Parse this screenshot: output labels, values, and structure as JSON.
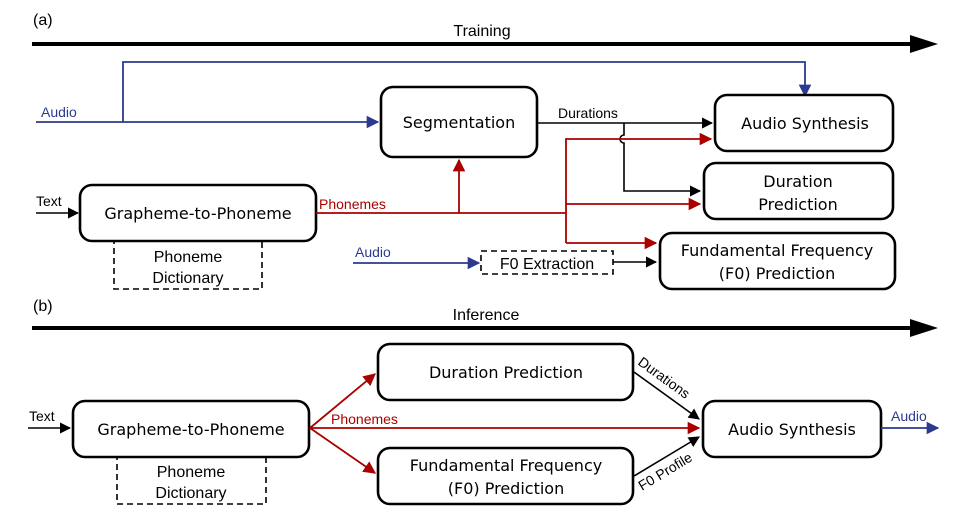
{
  "panel_a": {
    "label": "(a)",
    "timeline": "Training",
    "inputs": {
      "audio_top": "Audio",
      "text": "Text",
      "audio_f0": "Audio"
    },
    "boxes": {
      "segmentation": "Segmentation",
      "audio_synthesis": "Audio Synthesis",
      "duration_prediction": [
        "Duration",
        "Prediction"
      ],
      "f0_prediction": [
        "Fundamental Frequency",
        "(F0) Prediction"
      ],
      "g2p": "Grapheme-to-Phoneme",
      "phoneme_dictionary": [
        "Phoneme",
        "Dictionary"
      ],
      "f0_extraction": "F0 Extraction"
    },
    "edge_labels": {
      "durations": "Durations",
      "phonemes": "Phonemes"
    }
  },
  "panel_b": {
    "label": "(b)",
    "timeline": "Inference",
    "inputs": {
      "text": "Text"
    },
    "outputs": {
      "audio": "Audio"
    },
    "boxes": {
      "g2p": "Grapheme-to-Phoneme",
      "phoneme_dictionary": [
        "Phoneme",
        "Dictionary"
      ],
      "duration_prediction": "Duration Prediction",
      "f0_prediction": [
        "Fundamental Frequency",
        "(F0) Prediction"
      ],
      "audio_synthesis": "Audio Synthesis"
    },
    "edge_labels": {
      "phonemes": "Phonemes",
      "durations": "Durations",
      "f0_profile": "F0 Profile"
    }
  },
  "colors": {
    "phonemes": "#aa0000",
    "audio": "#2b3a8f",
    "default": "#000000"
  }
}
